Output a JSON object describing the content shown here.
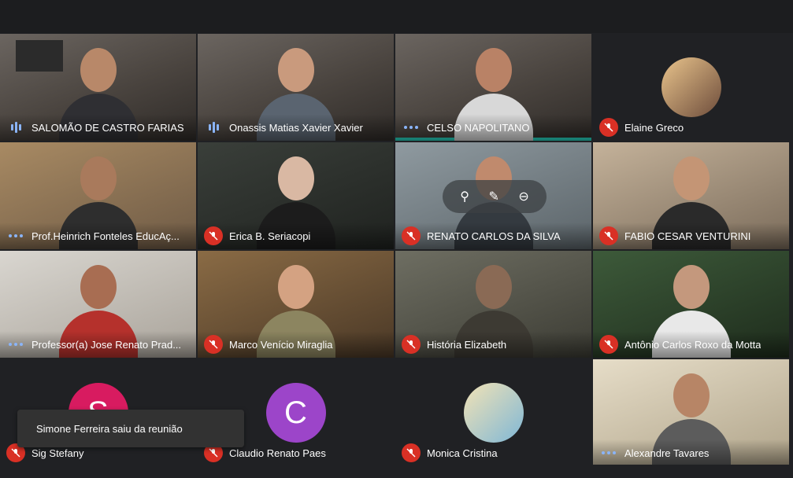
{
  "meeting": {
    "toast_message": "Simone Ferreira saiu da reunião"
  },
  "colors": {
    "mute_red": "#d93025",
    "speaking_blue": "#8ab4f8",
    "active_outline": "#27d8c4",
    "avatar_c": "#9c45c9",
    "avatar_s": "#d81b60"
  },
  "participants": [
    {
      "name": "SALOMÃO DE CASTRO FARIAS",
      "status": "speaking"
    },
    {
      "name": "Onassis Matias Xavier Xavier",
      "status": "speaking"
    },
    {
      "name": "CELSO NAPOLITANO",
      "status": "more"
    },
    {
      "name": "Elaine Greco",
      "status": "muted"
    },
    {
      "name": "Prof.Heinrich Fonteles EducAç...",
      "status": "more"
    },
    {
      "name": "Erica B. Seriacopi",
      "status": "muted"
    },
    {
      "name": "RENATO CARLOS DA SILVA",
      "status": "muted"
    },
    {
      "name": "FABIO CESAR VENTURINI",
      "status": "muted"
    },
    {
      "name": "Professor(a) Jose Renato Prad...",
      "status": "more"
    },
    {
      "name": "Marco Venício Miraglia",
      "status": "muted"
    },
    {
      "name": "História Elizabeth",
      "status": "muted"
    },
    {
      "name": "Antônio Carlos Roxo da Motta",
      "status": "muted"
    },
    {
      "name": "Sig Stefany",
      "status": "muted",
      "avatar_letter": "S"
    },
    {
      "name": "Claudio Renato Paes",
      "status": "muted",
      "avatar_letter": "C"
    },
    {
      "name": "Monica Cristina",
      "status": "muted"
    },
    {
      "name": "Alexandre Tavares",
      "status": "more"
    }
  ]
}
